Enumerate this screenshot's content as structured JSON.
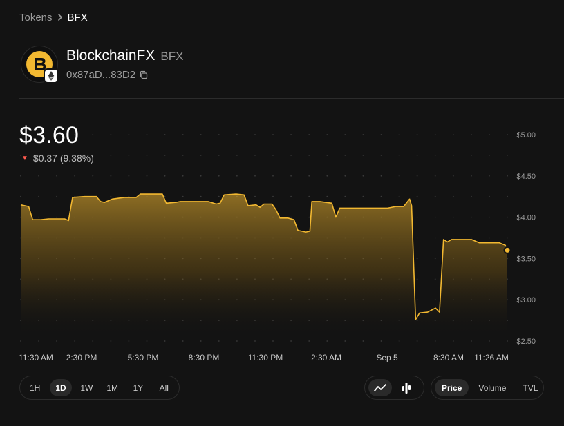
{
  "breadcrumb": {
    "parent": "Tokens",
    "current": "BFX"
  },
  "token": {
    "name": "BlockchainFX",
    "symbol": "BFX",
    "address": "0x87aD...83D2"
  },
  "price": {
    "current": "$3.60",
    "change": "$0.37 (9.38%)",
    "direction": "down"
  },
  "colors": {
    "line": "#f2b831",
    "down": "#ff5a4e",
    "background": "#131313"
  },
  "chart_data": {
    "type": "area",
    "ylim": [
      2.5,
      5.0
    ],
    "y_ticks": [
      "$5.00",
      "$4.50",
      "$4.00",
      "$3.50",
      "$3.00",
      "$2.50"
    ],
    "x_ticks": [
      "11:30 AM",
      "2:30 PM",
      "5:30 PM",
      "8:30 PM",
      "11:30 PM",
      "2:30 AM",
      "Sep 5",
      "8:30 AM",
      "11:26 AM"
    ],
    "grid": "dotted",
    "points": [
      [
        0,
        4.15
      ],
      [
        0.1,
        4.14
      ],
      [
        0.2,
        4.13
      ],
      [
        0.3,
        3.97
      ],
      [
        0.5,
        3.97
      ],
      [
        0.7,
        3.98
      ],
      [
        1.0,
        3.98
      ],
      [
        1.1,
        3.98
      ],
      [
        1.2,
        3.96
      ],
      [
        1.3,
        4.24
      ],
      [
        1.6,
        4.25
      ],
      [
        1.9,
        4.25
      ],
      [
        2.0,
        4.19
      ],
      [
        2.1,
        4.18
      ],
      [
        2.3,
        4.22
      ],
      [
        2.6,
        4.24
      ],
      [
        2.9,
        4.24
      ],
      [
        3.0,
        4.28
      ],
      [
        3.3,
        4.28
      ],
      [
        3.55,
        4.28
      ],
      [
        3.65,
        4.17
      ],
      [
        3.9,
        4.18
      ],
      [
        4.0,
        4.19
      ],
      [
        4.3,
        4.19
      ],
      [
        4.7,
        4.19
      ],
      [
        4.9,
        4.16
      ],
      [
        5.0,
        4.17
      ],
      [
        5.1,
        4.27
      ],
      [
        5.4,
        4.28
      ],
      [
        5.6,
        4.27
      ],
      [
        5.7,
        4.14
      ],
      [
        5.9,
        4.15
      ],
      [
        6.0,
        4.12
      ],
      [
        6.1,
        4.16
      ],
      [
        6.3,
        4.16
      ],
      [
        6.4,
        4.09
      ],
      [
        6.5,
        3.99
      ],
      [
        6.7,
        3.99
      ],
      [
        6.85,
        3.97
      ],
      [
        6.95,
        3.84
      ],
      [
        7.05,
        3.83
      ],
      [
        7.15,
        3.82
      ],
      [
        7.25,
        3.83
      ],
      [
        7.3,
        4.19
      ],
      [
        7.5,
        4.19
      ],
      [
        7.8,
        4.17
      ],
      [
        7.9,
        4.0
      ],
      [
        8.0,
        4.11
      ],
      [
        8.3,
        4.11
      ],
      [
        8.7,
        4.11
      ],
      [
        9.0,
        4.11
      ],
      [
        9.2,
        4.11
      ],
      [
        9.4,
        4.13
      ],
      [
        9.6,
        4.13
      ],
      [
        9.75,
        4.22
      ],
      [
        9.8,
        4.14
      ],
      [
        9.9,
        2.76
      ],
      [
        10.0,
        2.84
      ],
      [
        10.2,
        2.85
      ],
      [
        10.4,
        2.9
      ],
      [
        10.5,
        2.85
      ],
      [
        10.6,
        3.73
      ],
      [
        10.7,
        3.7
      ],
      [
        10.8,
        3.73
      ],
      [
        11.0,
        3.73
      ],
      [
        11.3,
        3.73
      ],
      [
        11.5,
        3.69
      ],
      [
        11.8,
        3.69
      ],
      [
        12.0,
        3.69
      ],
      [
        12.15,
        3.66
      ],
      [
        12.2,
        3.6
      ]
    ]
  },
  "time_ranges": [
    "1H",
    "1D",
    "1W",
    "1M",
    "1Y",
    "All"
  ],
  "active_range": "1D",
  "chart_types": [
    "line-chart-icon",
    "candlestick-chart-icon"
  ],
  "metrics": [
    "Price",
    "Volume",
    "TVL"
  ],
  "active_metric": "Price"
}
